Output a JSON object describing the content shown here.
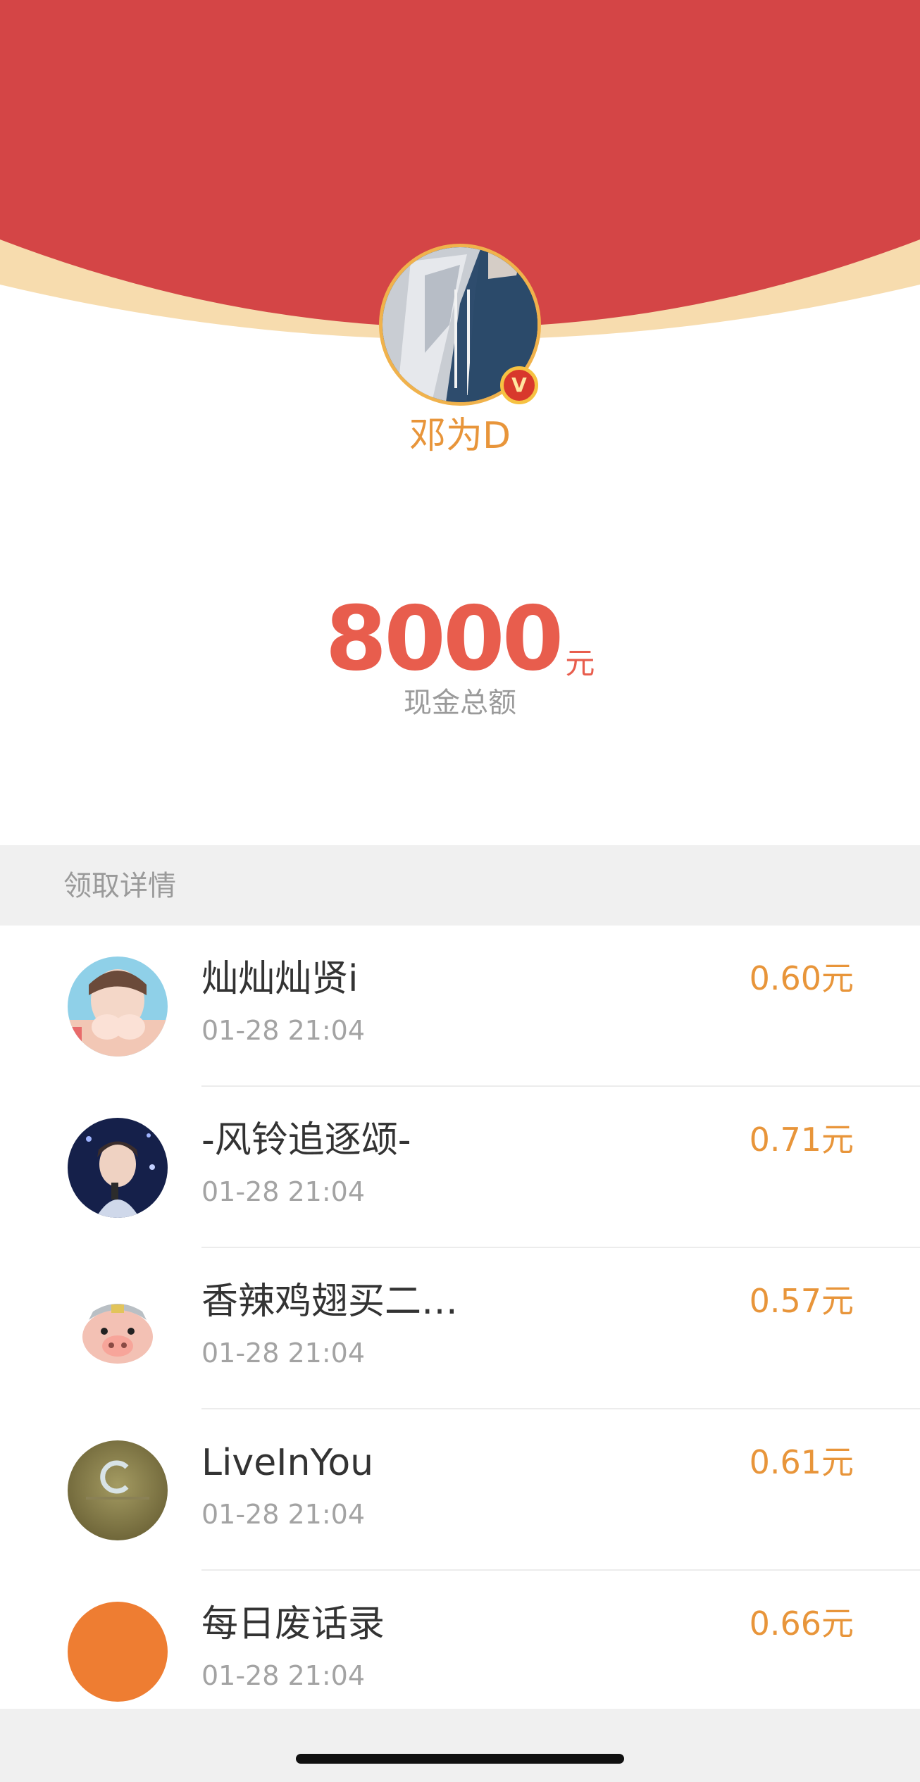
{
  "sender": {
    "name": "邓为D",
    "verified_mark": "V"
  },
  "amount": {
    "value": "8000",
    "unit": "元",
    "label": "现金总额"
  },
  "section": {
    "title": "领取详情"
  },
  "recipients": [
    {
      "name": "灿灿灿贤i",
      "time": "01-28 21:04",
      "amount": "0.60元"
    },
    {
      "name": "-风铃追逐颂-",
      "time": "01-28 21:04",
      "amount": "0.71元"
    },
    {
      "name": "香辣鸡翅买二…",
      "time": "01-28 21:04",
      "amount": "0.57元"
    },
    {
      "name": "LiveInYou",
      "time": "01-28 21:04",
      "amount": "0.61元"
    },
    {
      "name": "每日废话录",
      "time": "01-28 21:04",
      "amount": "0.66元"
    }
  ],
  "colors": {
    "envelope_red": "#d44546",
    "envelope_rim": "#f7dcae",
    "accent_orange": "#e8953a",
    "amount_red": "#e85d4d"
  }
}
